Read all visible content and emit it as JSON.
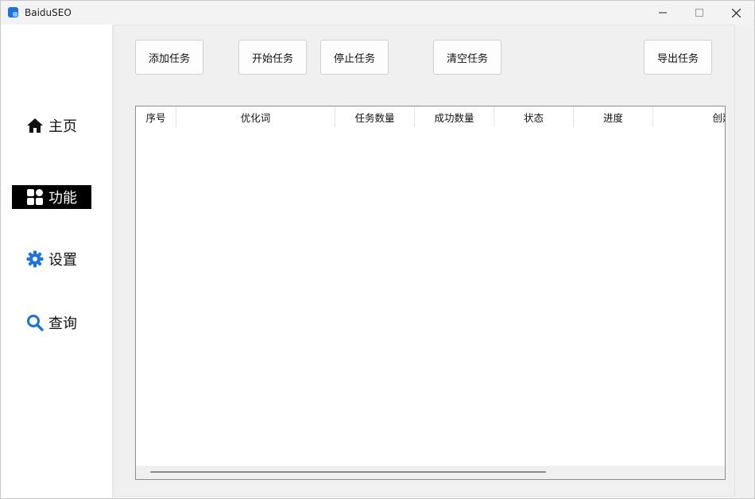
{
  "window": {
    "title": "BaiduSEO"
  },
  "sidebar": {
    "items": [
      {
        "label": "主页",
        "icon": "home-icon",
        "active": false
      },
      {
        "label": "功能",
        "icon": "grid-icon",
        "active": true
      },
      {
        "label": "设置",
        "icon": "gear-icon",
        "active": false
      },
      {
        "label": "查询",
        "icon": "search-icon",
        "active": false
      }
    ]
  },
  "toolbar": {
    "add_label": "添加任务",
    "start_label": "开始任务",
    "stop_label": "停止任务",
    "clear_label": "清空任务",
    "export_label": "导出任务"
  },
  "table": {
    "columns": [
      "序号",
      "优化词",
      "任务数量",
      "成功数量",
      "状态",
      "进度",
      "创建时间"
    ],
    "rows": []
  },
  "colors": {
    "accent": "#1a73e8",
    "active_nav_bg": "#000000"
  }
}
